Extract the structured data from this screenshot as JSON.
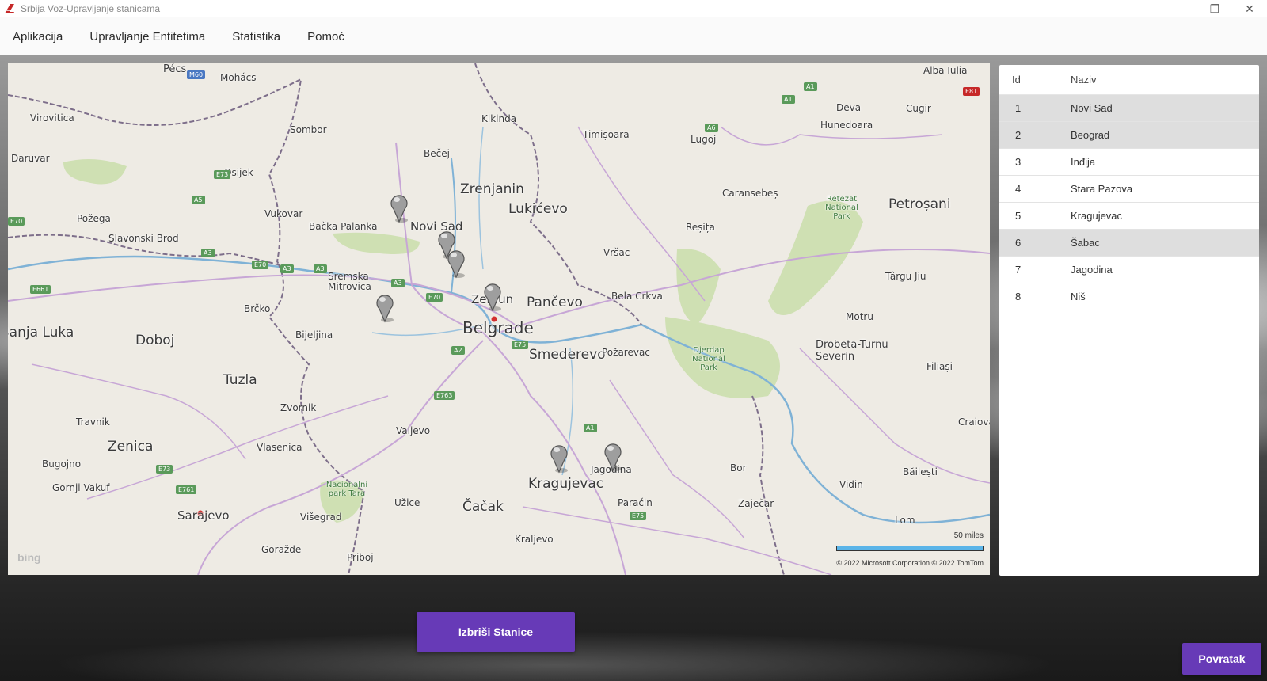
{
  "window": {
    "title": "Srbija Voz-Upravljanje stanicama",
    "controls": [
      "—",
      "❐",
      "✕"
    ]
  },
  "menu": {
    "items": [
      "Aplikacija",
      "Upravljanje Entitetima",
      "Statistika",
      "Pomoć"
    ]
  },
  "map": {
    "cities": [
      {
        "name": "Pécs",
        "size": "m"
      },
      {
        "name": "Mohács",
        "size": "s"
      },
      {
        "name": "Virovitica",
        "size": "s"
      },
      {
        "name": "Sombor",
        "size": "s"
      },
      {
        "name": "Kikinda",
        "size": "s"
      },
      {
        "name": "Timișoara",
        "size": "s"
      },
      {
        "name": "Lugoj",
        "size": "s"
      },
      {
        "name": "Deva",
        "size": "s"
      },
      {
        "name": "Hunedoara",
        "size": "s"
      },
      {
        "name": "Cugir",
        "size": "s"
      },
      {
        "name": "Alba Iulia",
        "size": "s"
      },
      {
        "name": "Daruvar",
        "size": "s"
      },
      {
        "name": "Osijek",
        "size": "s"
      },
      {
        "name": "Bečej",
        "size": "s"
      },
      {
        "name": "Zrenjanin",
        "size": "l"
      },
      {
        "name": "Lukićevo",
        "size": "l"
      },
      {
        "name": "Caransebeș",
        "size": "s"
      },
      {
        "name": "Petroșani",
        "size": "l"
      },
      {
        "name": "Požega",
        "size": "s"
      },
      {
        "name": "Vukovar",
        "size": "s"
      },
      {
        "name": "Bačka Palanka",
        "size": "s"
      },
      {
        "name": "Novi Sad",
        "size": "m"
      },
      {
        "name": "Reșița",
        "size": "s"
      },
      {
        "name": "Slavonski Brod",
        "size": "s"
      },
      {
        "name": "Vršac",
        "size": "s"
      },
      {
        "name": "Sremska Mitrovica",
        "size": "s"
      },
      {
        "name": "Zemun",
        "size": "m"
      },
      {
        "name": "Pančevo",
        "size": "l"
      },
      {
        "name": "Bela Crkva",
        "size": "s"
      },
      {
        "name": "Târgu Jiu",
        "size": "s"
      },
      {
        "name": "Brčko",
        "size": "s"
      },
      {
        "name": "Belgrade",
        "size": "xl"
      },
      {
        "name": "Motru",
        "size": "s"
      },
      {
        "name": "Banja Luka",
        "size": "l"
      },
      {
        "name": "Doboj",
        "size": "l"
      },
      {
        "name": "Bijeljina",
        "size": "s"
      },
      {
        "name": "Smederevo",
        "size": "l"
      },
      {
        "name": "Požarevac",
        "size": "s"
      },
      {
        "name": "Drobeta-Turnu Severin",
        "size": "m"
      },
      {
        "name": "Filiași",
        "size": "s"
      },
      {
        "name": "Tuzla",
        "size": "l"
      },
      {
        "name": "Zvornik",
        "size": "s"
      },
      {
        "name": "Travnik",
        "size": "s"
      },
      {
        "name": "Valjevo",
        "size": "s"
      },
      {
        "name": "Craiova",
        "size": "s"
      },
      {
        "name": "Zenica",
        "size": "l"
      },
      {
        "name": "Vlasenica",
        "size": "s"
      },
      {
        "name": "Jagodina",
        "size": "s"
      },
      {
        "name": "Bugojno",
        "size": "s"
      },
      {
        "name": "Bor",
        "size": "s"
      },
      {
        "name": "Băilești",
        "size": "s"
      },
      {
        "name": "Gornji Vakuf",
        "size": "s"
      },
      {
        "name": "Kragujevac",
        "size": "l"
      },
      {
        "name": "Vidin",
        "size": "s"
      },
      {
        "name": "Užice",
        "size": "s"
      },
      {
        "name": "Čačak",
        "size": "l"
      },
      {
        "name": "Paraćin",
        "size": "s"
      },
      {
        "name": "Zaječar",
        "size": "s"
      },
      {
        "name": "Sarajevo",
        "size": "l"
      },
      {
        "name": "Višegrad",
        "size": "s"
      },
      {
        "name": "Lom",
        "size": "s"
      },
      {
        "name": "Kraljevo",
        "size": "s"
      },
      {
        "name": "Goražde",
        "size": "s"
      },
      {
        "name": "Priboj",
        "size": "s"
      }
    ],
    "parks": [
      "Retezat National Park",
      "Djerdap National Park",
      "Nacionalni park Tara"
    ],
    "road_shields": [
      "M60",
      "A1",
      "A1",
      "E81",
      "A6",
      "E73",
      "A5",
      "E70",
      "A3",
      "E70",
      "A3",
      "A3",
      "A3",
      "E661",
      "E70",
      "A2",
      "E75",
      "E763",
      "A1",
      "E73",
      "E761",
      "E75"
    ],
    "scale_label": "50 miles",
    "copyright": "© 2022 Microsoft Corporation   © 2022 TomTom",
    "logo": "bing"
  },
  "table": {
    "columns": [
      "Id",
      "Naziv"
    ],
    "rows": [
      {
        "id": "1",
        "name": "Novi Sad",
        "selected": true
      },
      {
        "id": "2",
        "name": "Beograd",
        "selected": true
      },
      {
        "id": "3",
        "name": "Inđija",
        "selected": false
      },
      {
        "id": "4",
        "name": "Stara Pazova",
        "selected": false
      },
      {
        "id": "5",
        "name": "Kragujevac",
        "selected": false
      },
      {
        "id": "6",
        "name": "Šabac",
        "selected": true
      },
      {
        "id": "7",
        "name": "Jagodina",
        "selected": false
      },
      {
        "id": "8",
        "name": "Niš",
        "selected": false
      }
    ]
  },
  "buttons": {
    "delete_label": "Izbriši Stanice",
    "back_label": "Povratak"
  },
  "colors": {
    "accent": "#673ab7",
    "selected_row": "#dedede"
  }
}
